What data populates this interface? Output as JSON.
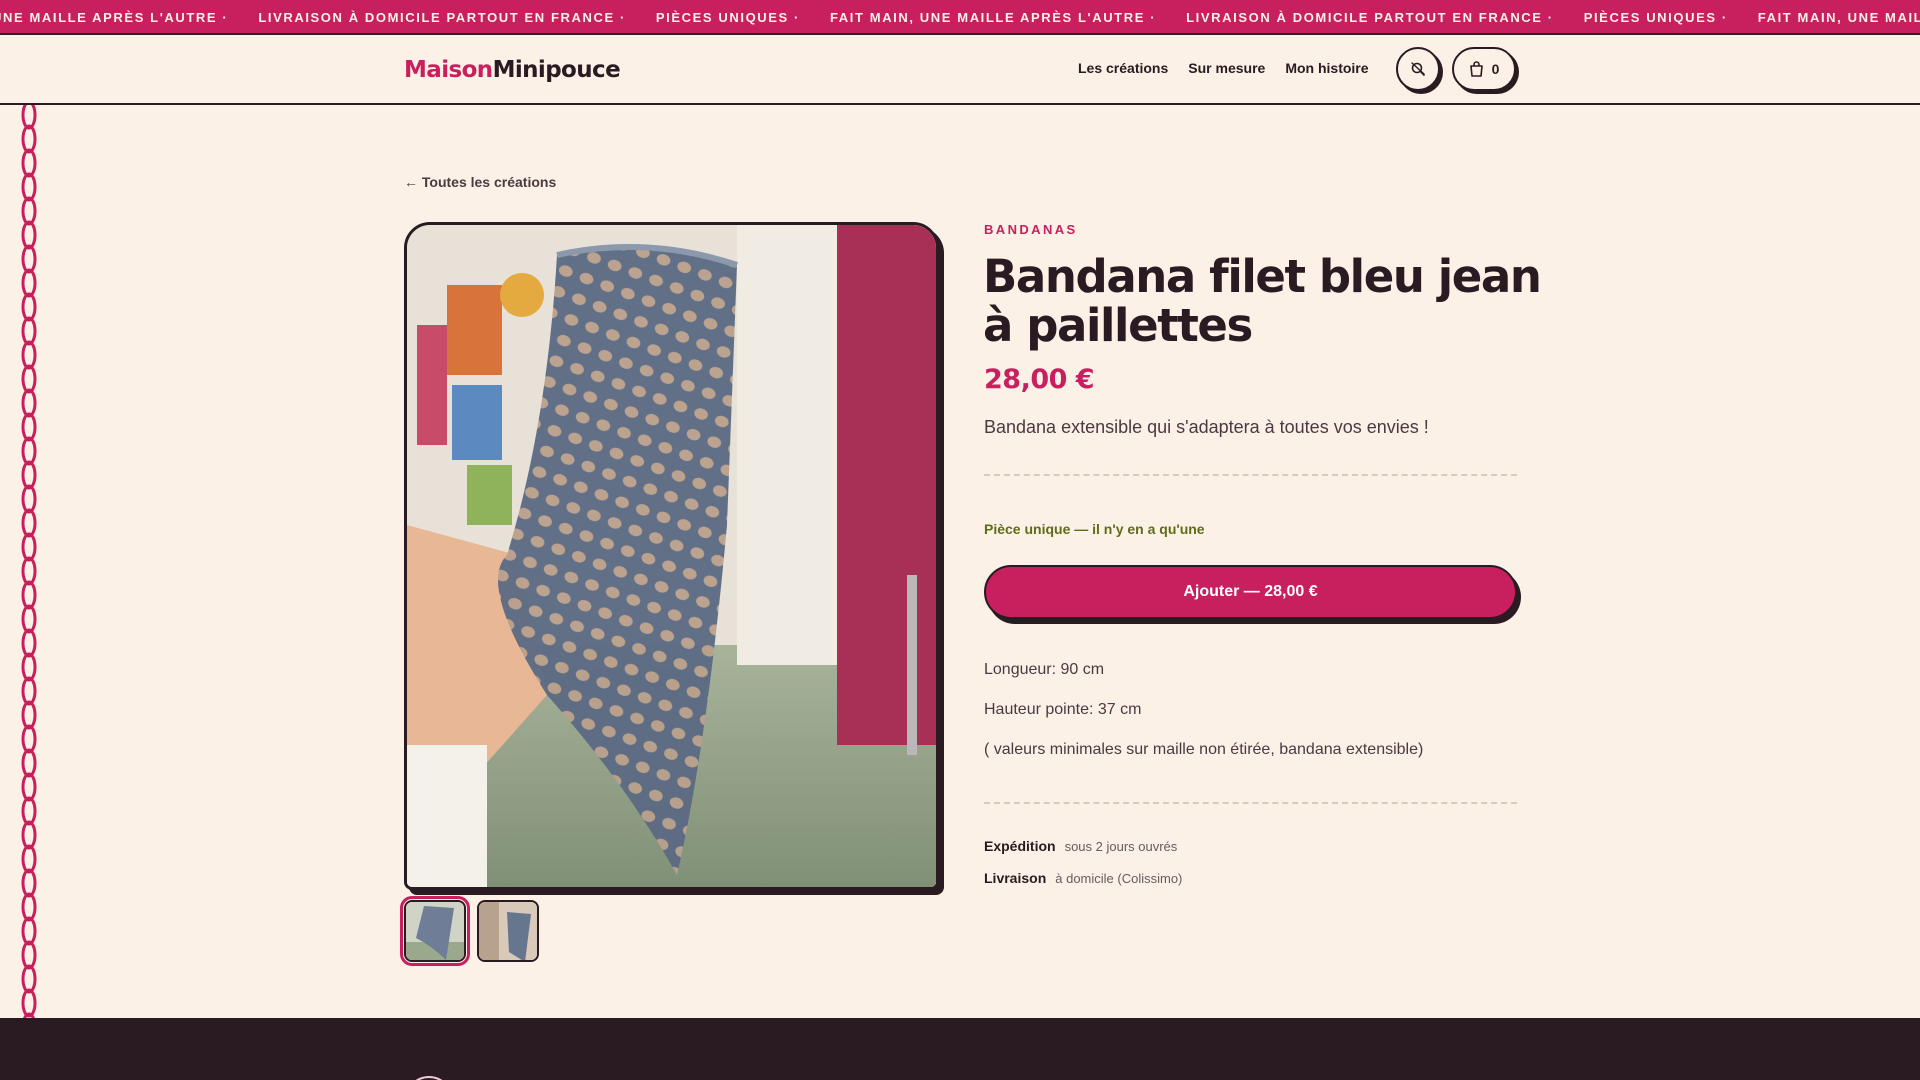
{
  "marquee": {
    "items": [
      "UNE MAILLE APRÈS L'AUTRE ·",
      "LIVRAISON À DOMICILE PARTOUT EN FRANCE ·",
      "PIÈCES UNIQUES ·",
      "FAIT MAIN, UNE MAILLE APRÈS L'AUTRE ·",
      "LIVRAISON À DOMICILE PARTOUT EN FRANCE ·",
      "PIÈCES UNIQUES ·",
      "FAIT MAIN, UNE MAILLE"
    ]
  },
  "header": {
    "logo_part1": "Maison",
    "logo_part2": "Minipouce",
    "nav": [
      "Les créations",
      "Sur mesure",
      "Mon histoire"
    ],
    "cart_count": "0",
    "icons": {
      "search": "search-off-icon",
      "cart": "shopping-bag-icon"
    }
  },
  "product": {
    "back_link": "← Toutes les créations",
    "category": "BANDANAS",
    "title": "Bandana filet bleu jean à paillettes",
    "price": "28,00 €",
    "short_description": "Bandana extensible qui s'adaptera à toutes vos envies !",
    "unique_note": "Pièce unique — il n'y en a qu'une",
    "add_button": "Ajouter — 28,00 €",
    "specs": [
      "Longueur: 90 cm",
      "Hauteur pointe: 37 cm",
      "( valeurs minimales sur maille non étirée, bandana extensible)"
    ],
    "shipping": [
      {
        "label": "Expédition",
        "value": "sous 2 jours ouvrés"
      },
      {
        "label": "Livraison",
        "value": "à domicile (Colissimo)"
      }
    ]
  },
  "colors": {
    "accent": "#c81f5e",
    "ink": "#2a1a22",
    "background": "#fbf1e6",
    "success": "#5d6d1a"
  }
}
